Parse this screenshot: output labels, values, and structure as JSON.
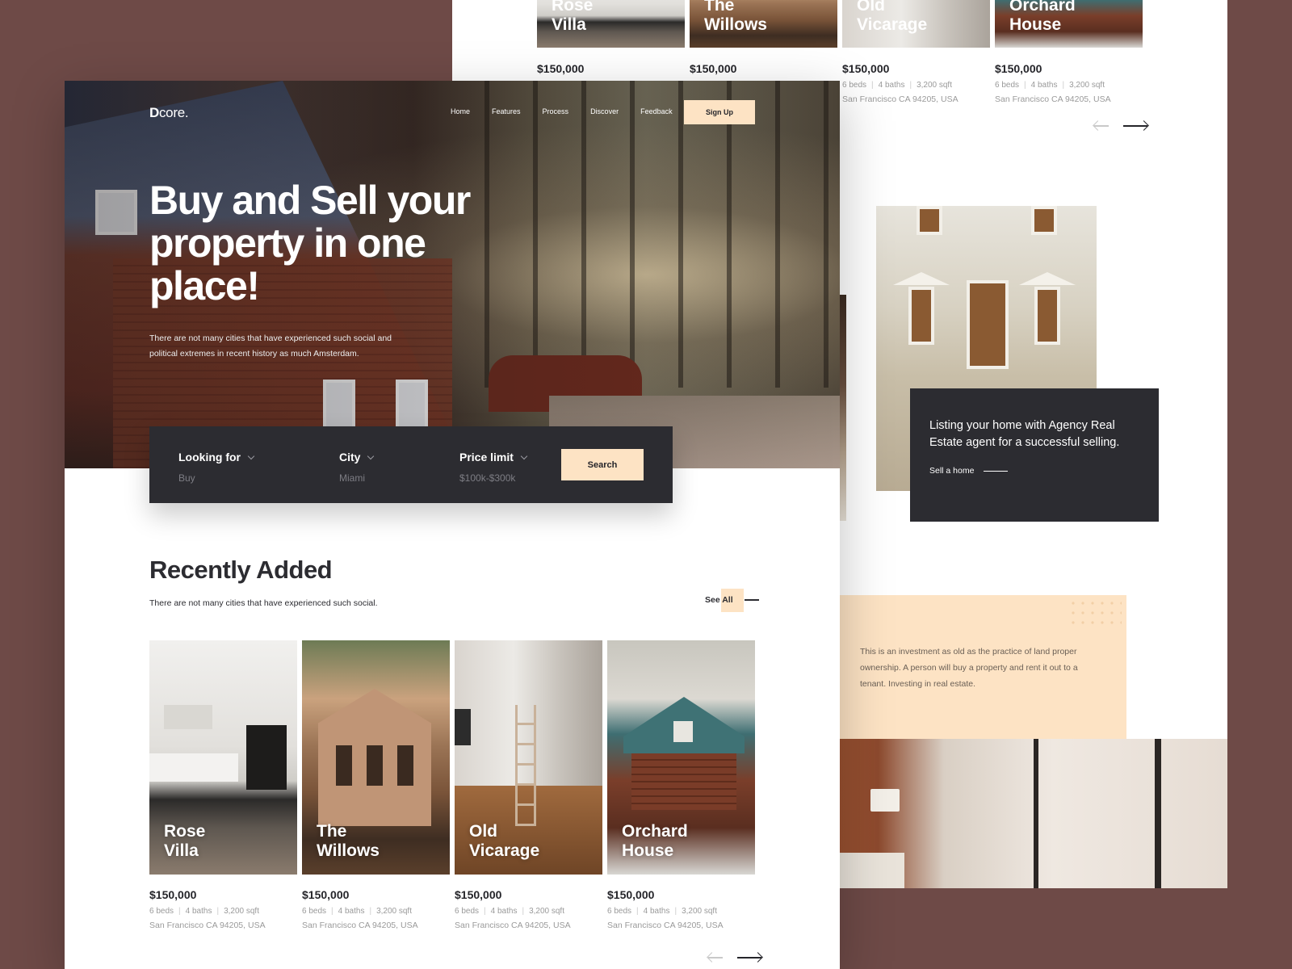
{
  "colors": {
    "background": "#6e4a47",
    "dark": "#2c2c31",
    "accent": "#fde3c4",
    "text": "#25252a",
    "muted": "#9a9a9a"
  },
  "back_page": {
    "cards": [
      {
        "name_line1": "Rose",
        "name_line2": "Villa",
        "price": "$150,000"
      },
      {
        "name_line1": "The",
        "name_line2": "Willows",
        "price": "$150,000"
      },
      {
        "name_line1": "Old",
        "name_line2": "Vicarage",
        "price": "$150,000",
        "beds": "6 beds",
        "baths": "4 baths",
        "sqft": "3,200 sqft",
        "address": "San Francisco CA 94205, USA"
      },
      {
        "name_line1": "Orchard",
        "name_line2": "House",
        "price": "$150,000",
        "beds": "6 beds",
        "baths": "4 baths",
        "sqft": "3,200 sqft",
        "address": "San Francisco CA 94205, USA"
      }
    ],
    "agency": {
      "text": "Listing your home with Agency Real Estate agent for a successful selling.",
      "link": "Sell a home"
    },
    "invest": {
      "text": "This is an investment as old as the practice of land proper ownership. A person will buy a property and rent it out to a tenant. Investing in real estate."
    }
  },
  "nav": {
    "logo_d": "D",
    "logo_rest": "core.",
    "links": [
      "Home",
      "Features",
      "Process",
      "Discover",
      "Feedback"
    ],
    "signup": "Sign Up"
  },
  "hero": {
    "title": "Buy and Sell your property in one place!",
    "subtitle": "There are not many cities that have experienced such social and political extremes in recent history as much Amsterdam."
  },
  "search": {
    "looking_for": {
      "label": "Looking for",
      "value": "Buy"
    },
    "city": {
      "label": "City",
      "value": "Miami"
    },
    "price": {
      "label": "Price limit",
      "value": "$100k-$300k"
    },
    "button": "Search"
  },
  "recent": {
    "title": "Recently Added",
    "subtitle": "There are not many cities that have experienced such social.",
    "see_all_prefix": "See ",
    "see_all_highlight": "All",
    "cards": [
      {
        "name_line1": "Rose",
        "name_line2": "Villa",
        "price": "$150,000",
        "beds": "6 beds",
        "baths": "4 baths",
        "sqft": "3,200 sqft",
        "address": "San Francisco CA 94205, USA"
      },
      {
        "name_line1": "The",
        "name_line2": "Willows",
        "price": "$150,000",
        "beds": "6 beds",
        "baths": "4 baths",
        "sqft": "3,200 sqft",
        "address": "San Francisco CA 94205, USA"
      },
      {
        "name_line1": "Old",
        "name_line2": "Vicarage",
        "price": "$150,000",
        "beds": "6 beds",
        "baths": "4 baths",
        "sqft": "3,200 sqft",
        "address": "San Francisco CA 94205, USA"
      },
      {
        "name_line1": "Orchard",
        "name_line2": "House",
        "price": "$150,000",
        "beds": "6 beds",
        "baths": "4 baths",
        "sqft": "3,200 sqft",
        "address": "San Francisco CA 94205, USA"
      }
    ]
  }
}
